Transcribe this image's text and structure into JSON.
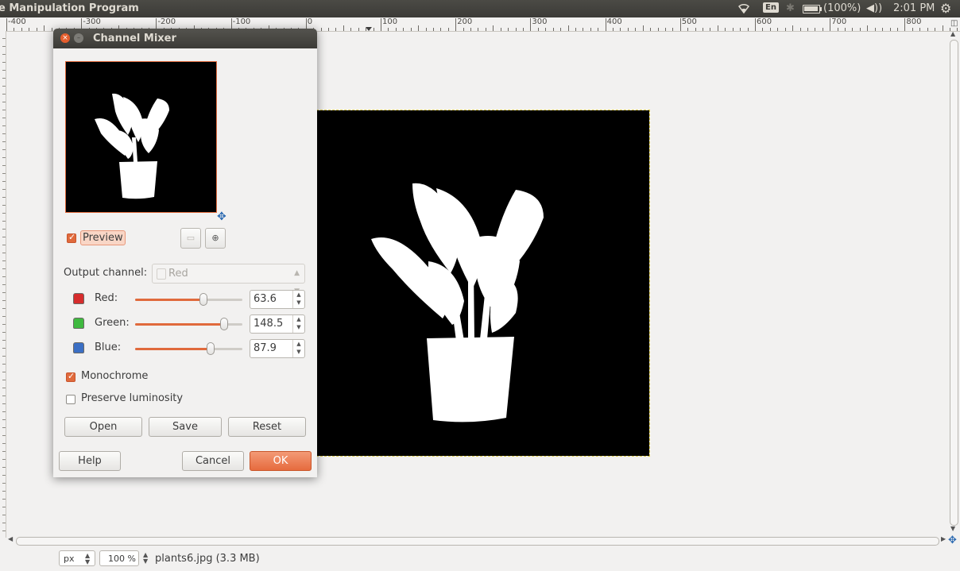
{
  "topbar": {
    "app_title": "e Manipulation Program",
    "lang": "En",
    "battery": "(100%)",
    "clock": "2:01 PM",
    "icons": [
      "wifi-icon",
      "bluetooth-icon",
      "battery-icon",
      "volume-icon",
      "settings-gear-icon"
    ]
  },
  "ruler": {
    "labels": [
      "-400",
      "-300",
      "-200",
      "-100",
      "0",
      "100",
      "200",
      "300",
      "400",
      "500",
      "600",
      "700",
      "800"
    ]
  },
  "dialog": {
    "title": "Channel Mixer",
    "preview_label": "Preview",
    "preview_checked": true,
    "output_channel_label": "Output channel:",
    "output_channel_value": "Red",
    "channels": [
      {
        "label": "Red:",
        "value": "63.6",
        "level": 0.64,
        "color": "#d62c2c"
      },
      {
        "label": "Green:",
        "value": "148.5",
        "level": 0.83,
        "color": "#3fb93f"
      },
      {
        "label": "Blue:",
        "value": "87.9",
        "level": 0.7,
        "color": "#3b6fc4"
      }
    ],
    "monochrome_label": "Monochrome",
    "monochrome_checked": true,
    "preserve_label": "Preserve luminosity",
    "preserve_checked": false,
    "buttons": {
      "open": "Open",
      "save": "Save",
      "reset": "Reset",
      "help": "Help",
      "cancel": "Cancel",
      "ok": "OK"
    }
  },
  "statusbar": {
    "unit": "px",
    "zoom": "100 %",
    "file": "plants6.jpg (3.3 MB)"
  },
  "accent_color": "#e06a3c"
}
